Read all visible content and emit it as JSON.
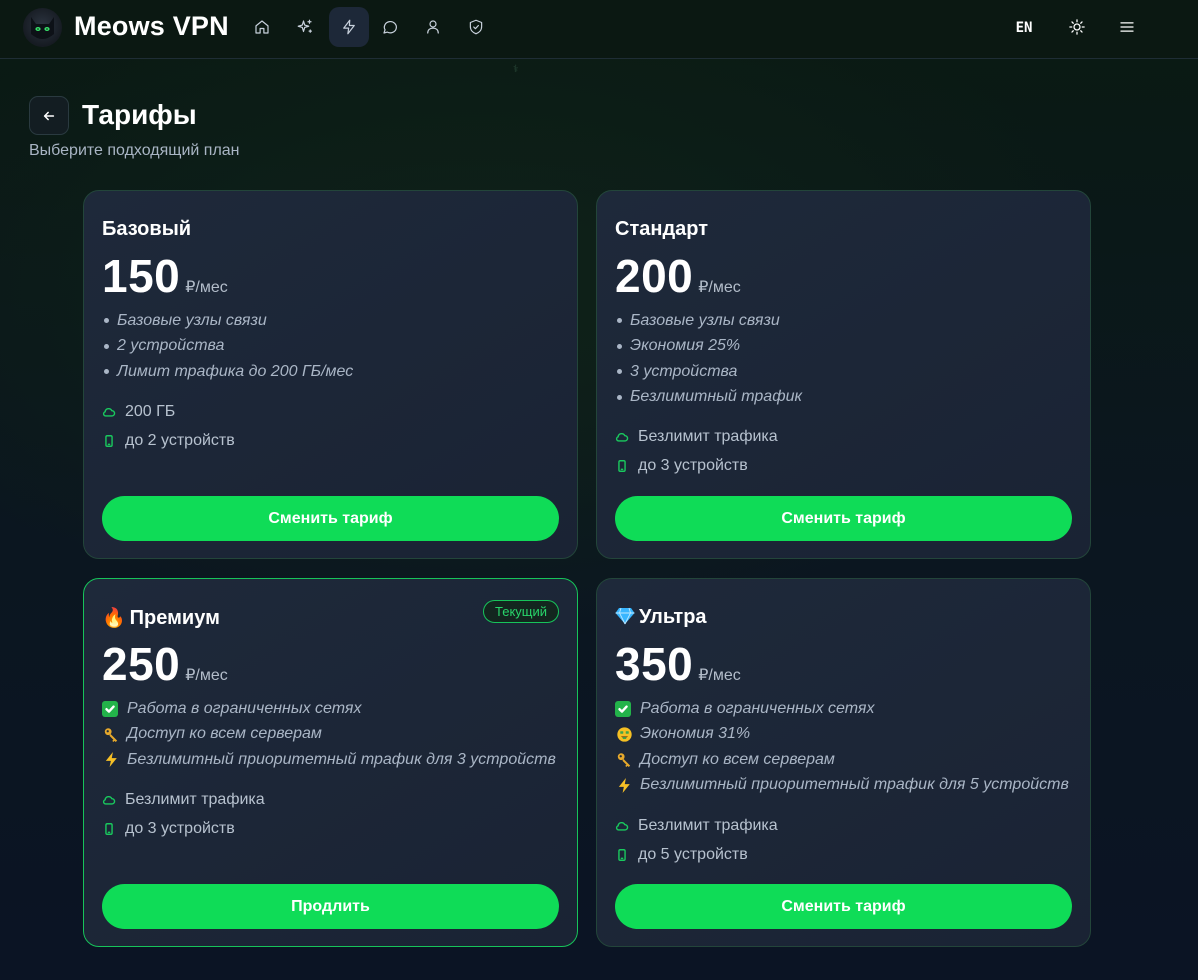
{
  "header": {
    "brand": "Meows VPN",
    "nav": [
      {
        "icon": "home-icon"
      },
      {
        "icon": "sparkles-icon"
      },
      {
        "icon": "bolt-icon",
        "active": true
      },
      {
        "icon": "chat-icon"
      },
      {
        "icon": "user-icon"
      },
      {
        "icon": "shield-icon"
      }
    ],
    "lang": "EN",
    "theme_icon": "sun-icon",
    "menu_icon": "menu-icon"
  },
  "page": {
    "title": "Тарифы",
    "subtitle": "Выберите подходящий план"
  },
  "plans": [
    {
      "name": "Базовый",
      "price": "150",
      "unit": "₽/мес",
      "features": [
        "Базовые узлы связи",
        "2 устройства",
        "Лимит трафика до 200 ГБ/мес"
      ],
      "traffic": "200 ГБ",
      "devices": "до 2 устройств",
      "button": "Сменить тариф"
    },
    {
      "name": "Стандарт",
      "price": "200",
      "unit": "₽/мес",
      "features": [
        "Базовые узлы связи",
        "Экономия 25%",
        "3 устройства",
        "Безлимитный трафик"
      ],
      "traffic": "Безлимит трафика",
      "devices": "до 3 устройств",
      "button": "Сменить тариф"
    },
    {
      "name": "Премиум",
      "name_emoji": "fire-icon",
      "price": "250",
      "unit": "₽/мес",
      "badge": "Текущий",
      "features": [
        "Работа в ограниченных сетях",
        "Доступ ко всем серверам",
        "Безлимитный приоритетный трафик для 3 устройств"
      ],
      "feature_icons": [
        "check-icon",
        "key-icon",
        "bolt-icon"
      ],
      "traffic": "Безлимит трафика",
      "devices": "до 3 устройств",
      "button": "Продлить"
    },
    {
      "name": "Ультра",
      "name_emoji": "gem-icon",
      "price": "350",
      "unit": "₽/мес",
      "features": [
        "Работа в ограниченных сетях",
        "Экономия 31%",
        "Доступ ко всем серверам",
        "Безлимитный приоритетный трафик для 5 устройств"
      ],
      "feature_icons": [
        "check-icon",
        "money-face-icon",
        "key-icon",
        "bolt-icon"
      ],
      "traffic": "Безлимит трафика",
      "devices": "до 5 устройств",
      "button": "Сменить тариф"
    }
  ],
  "colors": {
    "accent": "#0fdc57",
    "card_bg": "#1e293a",
    "current_border": "#17c35a"
  }
}
